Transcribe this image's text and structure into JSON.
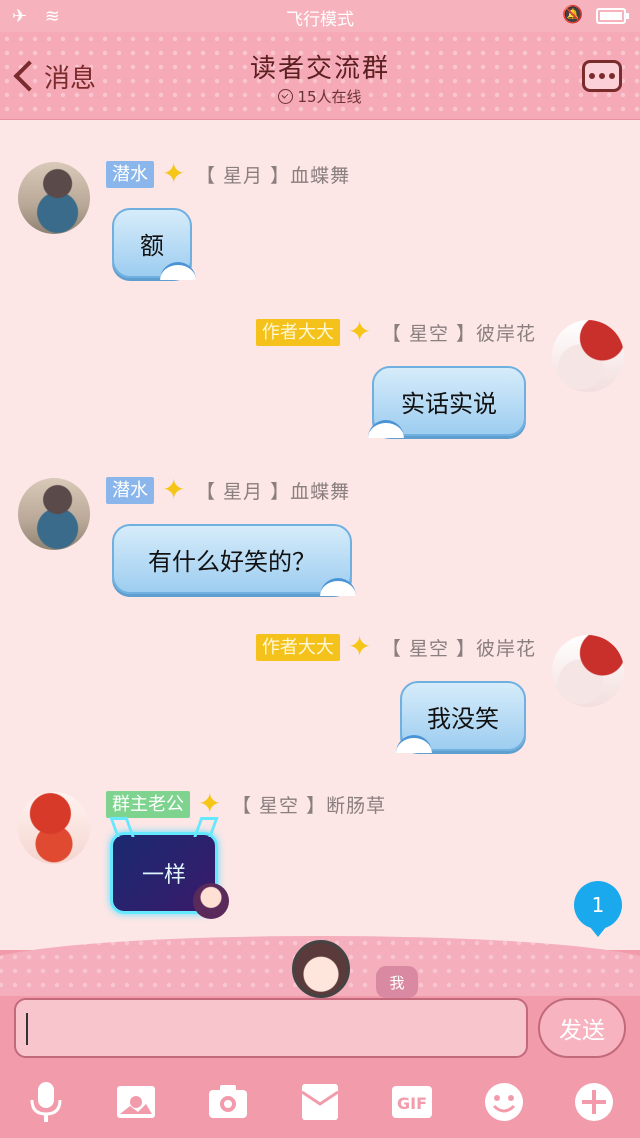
{
  "status_bar": {
    "mode_label": "飞行模式"
  },
  "header": {
    "back_label": "消息",
    "title": "读者交流群",
    "online_text": "15人在线"
  },
  "messages": [
    {
      "side": "left",
      "badge": "潜水",
      "badge_color": "#8ab6ec",
      "nickname": "【 星月 】血蝶舞",
      "text": "额"
    },
    {
      "side": "right",
      "badge": "作者大大",
      "badge_color": "#f4c21b",
      "nickname": "【 星空 】彼岸花",
      "text": "实话实说"
    },
    {
      "side": "left",
      "badge": "潜水",
      "badge_color": "#8ab6ec",
      "nickname": "【 星月 】血蝶舞",
      "text": "有什么好笑的？"
    },
    {
      "side": "right",
      "badge": "作者大大",
      "badge_color": "#f4c21b",
      "nickname": "【 星空 】彼岸花",
      "text": "我没笑"
    },
    {
      "side": "left",
      "badge": "群主老公",
      "badge_color": "#7ed38e",
      "nickname": "【 星空 】断肠草",
      "sticker_text": "一样"
    }
  ],
  "unread_count": "1",
  "input": {
    "value": "",
    "me_tag": "我",
    "send_label": "发送"
  },
  "toolbar": {
    "items": [
      "microphone-icon",
      "picture-icon",
      "camera-icon",
      "envelope-icon",
      "gif-icon",
      "emoji-icon",
      "plus-icon"
    ],
    "gif_label": "GIF"
  },
  "colors": {
    "header_bg": "#f6a9b6",
    "bubble": "#9dcdf0",
    "unread_badge": "#1aa9ec",
    "page_bg": "#fde6e6"
  }
}
